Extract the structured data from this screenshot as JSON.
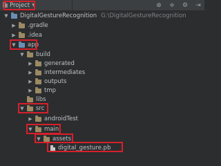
{
  "toolbar": {
    "project_label": "Project",
    "icons": [
      "globe-icon",
      "split-icon",
      "gear-icon",
      "hide-icon"
    ]
  },
  "tree": {
    "root": {
      "name": "DigitalGestureRecognition",
      "path": "G:\\DigitalGestureRecognition"
    },
    "gradle": ".gradle",
    "idea": ".idea",
    "app": "app",
    "build": "build",
    "generated": "generated",
    "intermediates": "intermediates",
    "outputs": "outputs",
    "tmp": "tmp",
    "libs": "libs",
    "src": "src",
    "androidTest": "androidTest",
    "main": "main",
    "assets": "assets",
    "model_file": "digital_gesture.pb"
  },
  "colors": {
    "highlight": "#d8202a",
    "background": "#2b2d2f",
    "folder": "#9b8a63"
  }
}
